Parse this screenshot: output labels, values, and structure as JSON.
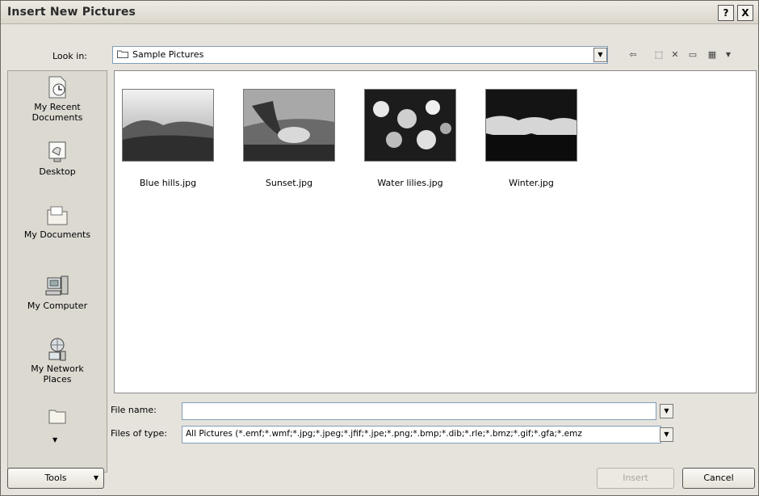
{
  "window": {
    "title": "Insert New Pictures",
    "help_label": "?",
    "close_label": "X"
  },
  "look_in": {
    "label": "Look in:",
    "value": "Sample Pictures"
  },
  "places": [
    {
      "label_line1": "My Recent",
      "label_line2": "Documents",
      "icon": "recent-documents-icon"
    },
    {
      "label_line1": "Desktop",
      "label_line2": "",
      "icon": "desktop-icon"
    },
    {
      "label_line1": "My Documents",
      "label_line2": "",
      "icon": "my-documents-icon"
    },
    {
      "label_line1": "My Computer",
      "label_line2": "",
      "icon": "my-computer-icon"
    },
    {
      "label_line1": "My Network",
      "label_line2": "Places",
      "icon": "network-places-icon"
    }
  ],
  "files": [
    {
      "name": "Blue hills.jpg"
    },
    {
      "name": "Sunset.jpg"
    },
    {
      "name": "Water lilies.jpg"
    },
    {
      "name": "Winter.jpg"
    }
  ],
  "file_name": {
    "label": "File name:",
    "value": ""
  },
  "file_type": {
    "label": "Files of type:",
    "value": "All Pictures (*.emf;*.wmf;*.jpg;*.jpeg;*.jfif;*.jpe;*.png;*.bmp;*.dib;*.rle;*.bmz;*.gif;*.gfa;*.emz"
  },
  "buttons": {
    "tools": "Tools",
    "insert": "Insert",
    "cancel": "Cancel"
  }
}
